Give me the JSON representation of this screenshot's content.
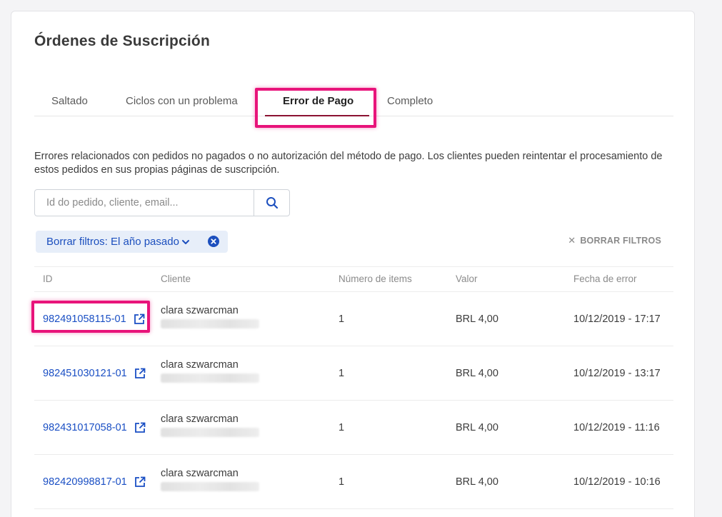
{
  "page": {
    "title": "Órdenes de Suscripción"
  },
  "tabs": [
    {
      "label": "Saltado"
    },
    {
      "label": "Ciclos con un problema"
    },
    {
      "label": "Error de Pago"
    },
    {
      "label": "Completo"
    }
  ],
  "active_tab": "Error de Pago",
  "description": "Errores relacionados con pedidos no pagados o no autorización del método de pago. Los clientes pueden reintentar el procesamiento de estos pedidos en sus propias páginas de suscripción.",
  "search": {
    "placeholder": "Id do pedido, cliente, email..."
  },
  "filter_chip": {
    "label": "Borrar filtros: El año pasado"
  },
  "clear_filters": {
    "label": "BORRAR FILTROS"
  },
  "table": {
    "headers": [
      "ID",
      "Cliente",
      "Número de items",
      "Valor",
      "Fecha de error"
    ],
    "rows": [
      {
        "id": "982491058115-01",
        "client": "clara szwarcman",
        "items": "1",
        "value": "BRL 4,00",
        "date": "10/12/2019 - 17:17"
      },
      {
        "id": "982451030121-01",
        "client": "clara szwarcman",
        "items": "1",
        "value": "BRL 4,00",
        "date": "10/12/2019 - 13:17"
      },
      {
        "id": "982431017058-01",
        "client": "clara szwarcman",
        "items": "1",
        "value": "BRL 4,00",
        "date": "10/12/2019 - 11:16"
      },
      {
        "id": "982420998817-01",
        "client": "clara szwarcman",
        "items": "1",
        "value": "BRL 4,00",
        "date": "10/12/2019 - 10:16"
      }
    ]
  },
  "colors": {
    "accent_link": "#1a4fc4",
    "active_tab_underline": "#8b1232",
    "annotation_highlight": "#e8137a",
    "chip_background": "#e7eef9"
  },
  "icons": {
    "search": "search-icon",
    "chevron": "chevron-down-icon",
    "chip_close": "close-circle-icon",
    "clear_x": "close-icon",
    "external_link": "external-link-icon"
  }
}
